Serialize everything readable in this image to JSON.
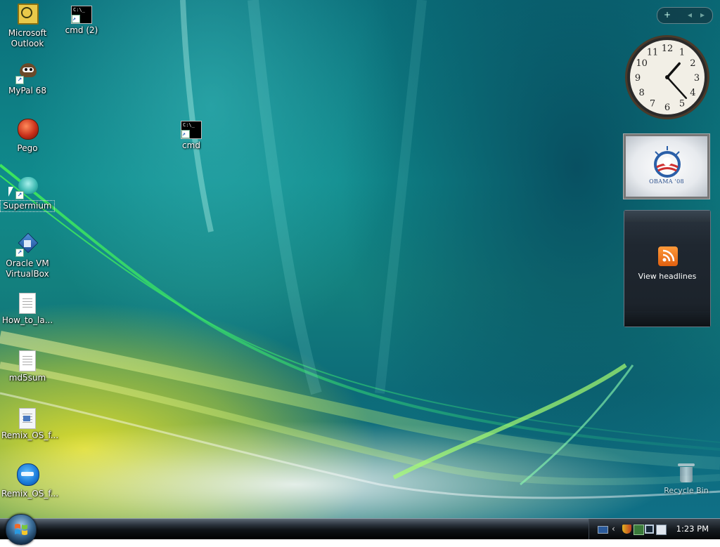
{
  "desktop": {
    "icons": [
      {
        "label": "Microsoft Outlook",
        "icon": "outlook-icon"
      },
      {
        "label": "cmd (2)",
        "icon": "cmd-icon"
      },
      {
        "label": "MyPal 68",
        "icon": "mypal-icon"
      },
      {
        "label": "Pego",
        "icon": "pego-icon"
      },
      {
        "label": "cmd",
        "icon": "cmd-icon"
      },
      {
        "label": "Supermium",
        "icon": "supermium-icon"
      },
      {
        "label": "Oracle VM VirtualBox",
        "icon": "virtualbox-icon"
      },
      {
        "label": "How_to_la...",
        "icon": "text-document-icon"
      },
      {
        "label": "md5sum",
        "icon": "text-document-icon"
      },
      {
        "label": "Remix_OS_f...",
        "icon": "document-icon"
      },
      {
        "label": "Remix_OS_f...",
        "icon": "remix-os-icon"
      }
    ],
    "recycle_bin": {
      "label": "Recycle Bin",
      "icon": "recycle-bin-icon"
    },
    "cmd_icon_text": "C:\\_"
  },
  "sidebar": {
    "controls": [
      "+",
      "◂",
      "▸"
    ],
    "clock": {
      "numerals": [
        "12",
        "1",
        "2",
        "3",
        "4",
        "5",
        "6",
        "7",
        "8",
        "9",
        "10",
        "11"
      ],
      "hour": 1,
      "minute": 23
    },
    "slideshow": {
      "caption": "OBAMA '08"
    },
    "feed": {
      "label": "View headlines"
    }
  },
  "taskbar": {
    "time": "1:23 PM",
    "tray_icons": [
      "keyboard-icon",
      "chevron-left-icon",
      "security-shield-icon",
      "network-icon",
      "display-icon",
      "window-icon"
    ]
  }
}
